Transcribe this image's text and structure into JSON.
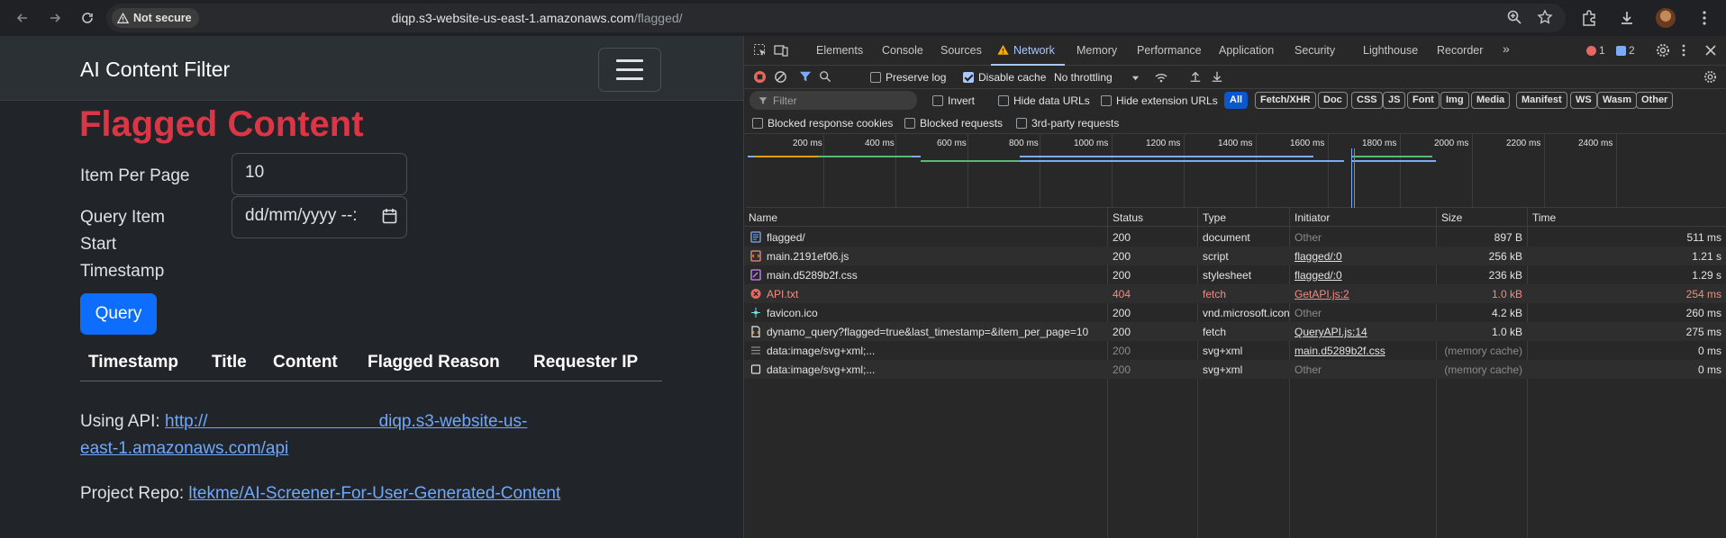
{
  "browser": {
    "security_label": "Not secure",
    "url_host": "diqp.s3-website-us-east-1.amazonaws.com",
    "url_path": "/flagged/"
  },
  "page": {
    "brand": "AI Content Filter",
    "heading": "Flagged Content",
    "item_per_page_label": "Item Per Page",
    "item_per_page_value": "10",
    "query_start_label_line1": "Query Item",
    "query_start_label_line2": "Start",
    "query_start_label_line3": "Timestamp",
    "query_start_placeholder": "dd/mm/yyyy --:",
    "query_button": "Query",
    "table_headers": [
      "Timestamp",
      "Title",
      "Content",
      "Flagged Reason",
      "Requester IP"
    ],
    "api_label": "Using API: ",
    "api_link_line1": "http://                                    diqp.s3-website-us-",
    "api_link_line2": "east-1.amazonaws.com/api",
    "repo_label": "Project Repo: ",
    "repo_link": "ltekme/AI-Screener-For-User-Generated-Content"
  },
  "devtools": {
    "tabs": [
      "Elements",
      "Console",
      "Sources",
      "Network",
      "Memory",
      "Performance",
      "Application",
      "Security",
      "Lighthouse",
      "Recorder"
    ],
    "active_tab": "Network",
    "error_count": "1",
    "message_count": "2",
    "preserve_log": "Preserve log",
    "disable_cache": "Disable cache",
    "throttling": "No throttling",
    "filter_placeholder": "Filter",
    "invert": "Invert",
    "hide_data_urls": "Hide data URLs",
    "hide_extension_urls": "Hide extension URLs",
    "type_filters": [
      "All",
      "Fetch/XHR",
      "Doc",
      "CSS",
      "JS",
      "Font",
      "Img",
      "Media",
      "Manifest",
      "WS",
      "Wasm",
      "Other"
    ],
    "blocked_cookies": "Blocked response cookies",
    "blocked_requests": "Blocked requests",
    "third_party": "3rd-party requests",
    "timeline_ticks": [
      "200 ms",
      "400 ms",
      "600 ms",
      "800 ms",
      "1000 ms",
      "1200 ms",
      "1400 ms",
      "1600 ms",
      "1800 ms",
      "2000 ms",
      "2200 ms",
      "2400 ms"
    ],
    "columns": [
      "Name",
      "Status",
      "Type",
      "Initiator",
      "Size",
      "Time"
    ],
    "rows": [
      {
        "name": "flagged/",
        "status": "200",
        "type": "document",
        "initiator": "Other",
        "size": "897 B",
        "time": "511 ms",
        "icon": "document-icon",
        "error": false,
        "init_link": false,
        "dim_status": false
      },
      {
        "name": "main.2191ef06.js",
        "status": "200",
        "type": "script",
        "initiator": "flagged/:0",
        "size": "256 kB",
        "time": "1.21 s",
        "icon": "script-icon",
        "error": false,
        "init_link": true,
        "dim_status": false
      },
      {
        "name": "main.d5289b2f.css",
        "status": "200",
        "type": "stylesheet",
        "initiator": "flagged/:0",
        "size": "236 kB",
        "time": "1.29 s",
        "icon": "stylesheet-icon",
        "error": false,
        "init_link": true,
        "dim_status": false
      },
      {
        "name": "API.txt",
        "status": "404",
        "type": "fetch",
        "initiator": "GetAPI.js:2",
        "size": "1.0 kB",
        "time": "254 ms",
        "icon": "error-icon",
        "error": true,
        "init_link": true,
        "dim_status": false
      },
      {
        "name": "favicon.ico",
        "status": "200",
        "type": "vnd.microsoft.icon",
        "initiator": "Other",
        "size": "4.2 kB",
        "time": "260 ms",
        "icon": "favicon-icon",
        "error": false,
        "init_link": false,
        "dim_status": false
      },
      {
        "name": "dynamo_query?flagged=true&last_timestamp=&item_per_page=10",
        "status": "200",
        "type": "fetch",
        "initiator": "QueryAPI.js:14",
        "size": "1.0 kB",
        "time": "275 ms",
        "icon": "fetch-icon",
        "error": false,
        "init_link": true,
        "dim_status": false
      },
      {
        "name": "data:image/svg+xml;...",
        "status": "200",
        "type": "svg+xml",
        "initiator": "main.d5289b2f.css",
        "size": "(memory cache)",
        "time": "0 ms",
        "icon": "svg-icon",
        "error": false,
        "init_link": true,
        "dim_status": true
      },
      {
        "name": "data:image/svg+xml;...",
        "status": "200",
        "type": "svg+xml",
        "initiator": "Other",
        "size": "(memory cache)",
        "time": "0 ms",
        "icon": "image-icon",
        "error": false,
        "init_link": false,
        "dim_status": true
      }
    ]
  }
}
